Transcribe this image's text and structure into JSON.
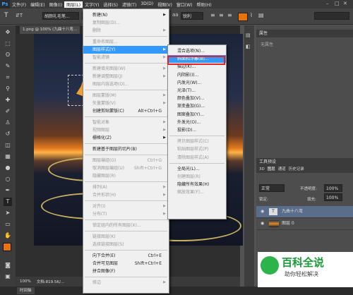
{
  "app": {
    "logo": "Ps"
  },
  "menubar": {
    "items": [
      "文件(F)",
      "编辑(E)",
      "图像(I)",
      "图层(L)",
      "文字(Y)",
      "选择(S)",
      "滤镜(T)",
      "3D(D)",
      "视图(V)",
      "窗口(W)",
      "帮助(H)"
    ],
    "active_index": 3
  },
  "options": {
    "font_name": "胡颜礼毛笔...",
    "aa_mode": "锐利",
    "tool_glyph": "T"
  },
  "document": {
    "tab_title": "1.png @ 100% (九曲十八弯..."
  },
  "status": {
    "zoom": "100%",
    "doc_info": "文档:819.5K/...",
    "bottom_tab": "时间轴"
  },
  "layer_menu": {
    "items": [
      {
        "label": "新建(N)",
        "arrow": true
      },
      {
        "label": "复制图层(D)...",
        "disabled": true
      },
      {
        "label": "删除",
        "arrow": true,
        "disabled": true
      },
      {
        "sep": true
      },
      {
        "label": "重命名图层...",
        "disabled": true
      },
      {
        "label": "图层样式(Y)",
        "arrow": true,
        "highlight": true
      },
      {
        "label": "智能滤镜",
        "arrow": true,
        "disabled": true
      },
      {
        "sep": true
      },
      {
        "label": "新建填充图层(W)",
        "arrow": true,
        "disabled": true
      },
      {
        "label": "新建调整图层(J)",
        "arrow": true,
        "disabled": true
      },
      {
        "label": "图层内容选项(O)...",
        "disabled": true
      },
      {
        "sep": true
      },
      {
        "label": "图层蒙版(M)",
        "arrow": true,
        "disabled": true
      },
      {
        "label": "矢量蒙版(V)",
        "arrow": true,
        "disabled": true
      },
      {
        "label": "创建剪贴蒙版(C)",
        "shortcut": "Alt+Ctrl+G"
      },
      {
        "sep": true
      },
      {
        "label": "智能对象",
        "arrow": true,
        "disabled": true
      },
      {
        "label": "视频图层",
        "arrow": true,
        "disabled": true
      },
      {
        "label": "栅格化(Z)",
        "arrow": true
      },
      {
        "sep": true
      },
      {
        "label": "新建基于图层的切片(B)"
      },
      {
        "sep": true
      },
      {
        "label": "图层编组(G)",
        "shortcut": "Ctrl+G",
        "disabled": true
      },
      {
        "label": "取消图层编组(U)",
        "shortcut": "Shift+Ctrl+G",
        "disabled": true
      },
      {
        "label": "隐藏图层(R)",
        "disabled": true
      },
      {
        "sep": true
      },
      {
        "label": "排列(A)",
        "arrow": true,
        "disabled": true
      },
      {
        "label": "合并形状(H)",
        "arrow": true,
        "disabled": true
      },
      {
        "sep": true
      },
      {
        "label": "对齐(I)",
        "arrow": true,
        "disabled": true
      },
      {
        "label": "分布(T)",
        "arrow": true,
        "disabled": true
      },
      {
        "sep": true
      },
      {
        "label": "锁定组内的所有图层(X)...",
        "disabled": true
      },
      {
        "sep": true
      },
      {
        "label": "链接图层(K)",
        "disabled": true
      },
      {
        "label": "选择链接图层(S)",
        "disabled": true
      },
      {
        "sep": true
      },
      {
        "label": "向下合并(E)",
        "shortcut": "Ctrl+E"
      },
      {
        "label": "合并可见图层",
        "shortcut": "Shift+Ctrl+E"
      },
      {
        "label": "拼合图像(F)"
      },
      {
        "sep": true
      },
      {
        "label": "修边",
        "arrow": true,
        "disabled": true
      }
    ]
  },
  "style_menu": {
    "items": [
      {
        "label": "混合选项(N)..."
      },
      {
        "label": "斜面和浮雕(B)...",
        "highlight": true
      },
      {
        "label": "描边(K)..."
      },
      {
        "label": "内阴影(I)..."
      },
      {
        "label": "内发光(W)..."
      },
      {
        "label": "光泽(T)..."
      },
      {
        "label": "颜色叠加(V)..."
      },
      {
        "label": "渐变叠加(G)..."
      },
      {
        "label": "图案叠加(Y)..."
      },
      {
        "label": "外发光(O)..."
      },
      {
        "label": "投影(D)..."
      },
      {
        "sep": true
      },
      {
        "label": "拷贝图层样式(C)",
        "disabled": true
      },
      {
        "label": "粘贴图层样式(P)",
        "disabled": true
      },
      {
        "label": "清除图层样式(A)",
        "disabled": true
      },
      {
        "sep": true
      },
      {
        "label": "全局光(L)..."
      },
      {
        "label": "创建图层(R)",
        "disabled": true
      },
      {
        "label": "隐藏所有效果(H)"
      },
      {
        "label": "缩放效果(F)...",
        "disabled": true
      }
    ]
  },
  "properties_panel": {
    "title": "属性",
    "empty_text": "无属性"
  },
  "layers_panel": {
    "tabs": [
      "3D",
      "图层",
      "通道",
      "历史记录"
    ],
    "mode": "正常",
    "opacity_label": "不透明度:",
    "opacity_value": "100%",
    "lock_label": "锁定:",
    "fill_label": "填充:",
    "fill_value": "100%",
    "layers": [
      {
        "name": "九曲十八弯",
        "type_glyph": "T",
        "selected": true
      },
      {
        "name": "图层 0",
        "selected": false
      }
    ],
    "tools_title": "工具预设"
  },
  "watermark": {
    "title": "百科全说",
    "subtitle": "助你轻松解决"
  },
  "colors": {
    "highlight": "#3399ff",
    "menu_bg": "#f0f0f0",
    "fg_swatch": "#e8720c",
    "red_box": "#e52222"
  }
}
